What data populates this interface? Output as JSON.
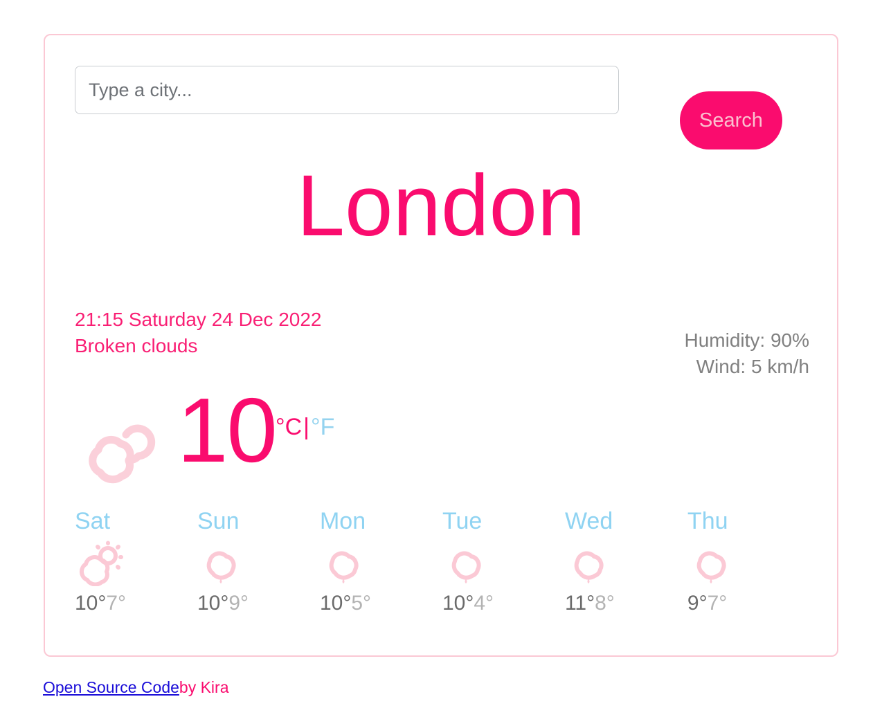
{
  "search": {
    "placeholder": "Type a city...",
    "value": "",
    "button_label": "Search"
  },
  "city": "London",
  "current": {
    "datetime": "21:15 Saturday 24 Dec 2022",
    "description": "Broken clouds",
    "humidity": "Humidity: 90%",
    "wind": "Wind: 5 km/h",
    "temperature": "10",
    "unit_celsius": "°C",
    "unit_separator": "|",
    "unit_fahrenheit": "°F",
    "icon": "broken-clouds-icon"
  },
  "forecast": [
    {
      "day": "Sat",
      "icon": "sun-behind-cloud-icon",
      "max": "10°",
      "min": "7°"
    },
    {
      "day": "Sun",
      "icon": "rain-cloud-icon",
      "max": "10°",
      "min": "9°"
    },
    {
      "day": "Mon",
      "icon": "rain-cloud-icon",
      "max": "10°",
      "min": "5°"
    },
    {
      "day": "Tue",
      "icon": "rain-cloud-icon",
      "max": "10°",
      "min": "4°"
    },
    {
      "day": "Wed",
      "icon": "rain-cloud-icon",
      "max": "11°",
      "min": "8°"
    },
    {
      "day": "Thu",
      "icon": "rain-cloud-icon",
      "max": "9°",
      "min": "7°"
    }
  ],
  "footer": {
    "link_text": "Open Source Code",
    "author_text": "by Kira"
  },
  "colors": {
    "accent_pink": "#fa0c6e",
    "light_pink": "#fbc8d4",
    "light_blue": "#8fd3f2",
    "gray_text": "#808080",
    "link_blue": "#1a0dd8"
  }
}
